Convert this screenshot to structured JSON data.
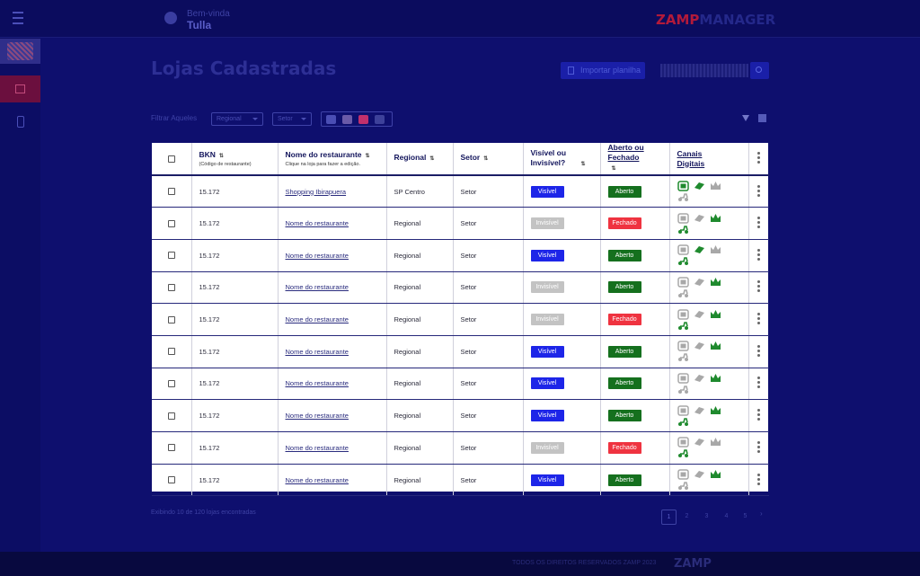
{
  "header": {
    "welcome": "Bem-vinda",
    "user_name": "Tulla",
    "logo_primary": "ZAMP",
    "logo_secondary": "MANAGER"
  },
  "page": {
    "title": "Lojas Cadastradas",
    "export_label": "Importar planilha",
    "search_placeholder": ""
  },
  "filters": {
    "label": "Filtrar Aqueles",
    "regional": "Regional",
    "setor": "Setor"
  },
  "table": {
    "headers": {
      "bkn": "BKN",
      "bkn_sub": "(Código de restaurante)",
      "name": "Nome do restaurante",
      "name_sub": "Clique na loja para fazer a edição.",
      "regional": "Regional",
      "setor": "Setor",
      "visible": "Visível ou Invisível?",
      "open": "Aberto ou Fechado",
      "channels": "Canais Digitais"
    },
    "rows": [
      {
        "bkn": "15.172",
        "name": "Shopping Ibirapuera",
        "regional": "SP Centro",
        "setor": "Setor",
        "visibility": "Visível",
        "status": "Aberto",
        "channels": [
          true,
          true,
          false,
          false
        ]
      },
      {
        "bkn": "15.172",
        "name": "Nome do restaurante",
        "regional": "Regional",
        "setor": "Setor",
        "visibility": "Invisível",
        "status": "Fechado",
        "channels": [
          false,
          false,
          true,
          true
        ]
      },
      {
        "bkn": "15.172",
        "name": "Nome do restaurante",
        "regional": "Regional",
        "setor": "Setor",
        "visibility": "Visível",
        "status": "Aberto",
        "channels": [
          false,
          true,
          false,
          true
        ]
      },
      {
        "bkn": "15.172",
        "name": "Nome do restaurante",
        "regional": "Regional",
        "setor": "Setor",
        "visibility": "Invisível",
        "status": "Aberto",
        "channels": [
          false,
          false,
          true,
          false
        ]
      },
      {
        "bkn": "15.172",
        "name": "Nome do restaurante",
        "regional": "Regional",
        "setor": "Setor",
        "visibility": "Invisível",
        "status": "Fechado",
        "channels": [
          false,
          false,
          true,
          true
        ]
      },
      {
        "bkn": "15.172",
        "name": "Nome do restaurante",
        "regional": "Regional",
        "setor": "Setor",
        "visibility": "Visível",
        "status": "Aberto",
        "channels": [
          false,
          false,
          true,
          false
        ]
      },
      {
        "bkn": "15.172",
        "name": "Nome do restaurante",
        "regional": "Regional",
        "setor": "Setor",
        "visibility": "Visível",
        "status": "Aberto",
        "channels": [
          false,
          false,
          true,
          false
        ]
      },
      {
        "bkn": "15.172",
        "name": "Nome do restaurante",
        "regional": "Regional",
        "setor": "Setor",
        "visibility": "Visível",
        "status": "Aberto",
        "channels": [
          false,
          false,
          true,
          true
        ]
      },
      {
        "bkn": "15.172",
        "name": "Nome do restaurante",
        "regional": "Regional",
        "setor": "Setor",
        "visibility": "Invisível",
        "status": "Fechado",
        "channels": [
          false,
          false,
          false,
          true
        ]
      },
      {
        "bkn": "15.172",
        "name": "Nome do restaurante",
        "regional": "Regional",
        "setor": "Setor",
        "visibility": "Visível",
        "status": "Aberto",
        "channels": [
          false,
          false,
          true,
          false
        ]
      }
    ]
  },
  "pagination": {
    "info_prefix": "Exibindo",
    "info_count": "10",
    "info_suffix": "de 120 lojas encontradas",
    "pages": [
      "1",
      "2",
      "3",
      "4",
      "5"
    ],
    "next": "›"
  },
  "footer": {
    "copyright": "TODOS OS DIREITOS RESERVADOS ZAMP 2023",
    "logo": "ZAMP"
  },
  "colors": {
    "visible": "#1d25e8",
    "invisible": "#c3c3c3",
    "open": "#15701e",
    "closed": "#ef3340",
    "channel_active": "#1f8a2e",
    "channel_inactive": "#a8a8a8"
  },
  "channel_icons": [
    "ifood-icon",
    "rappi-icon",
    "crown-icon",
    "delivery-scooter-icon"
  ]
}
